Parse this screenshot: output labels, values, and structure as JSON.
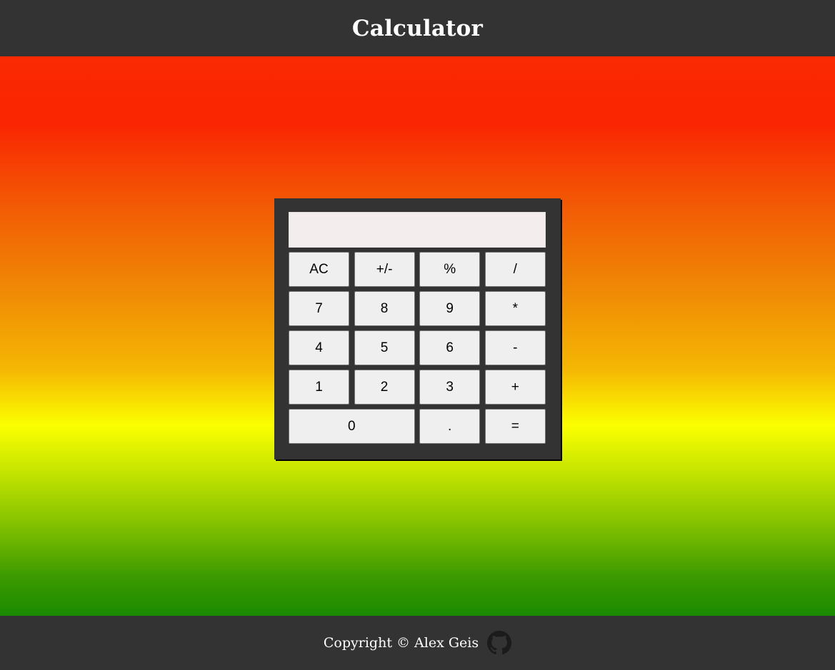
{
  "header": {
    "title": "Calculator"
  },
  "display": {
    "value": ""
  },
  "keys": [
    [
      "AC",
      "+/-",
      "%",
      "/"
    ],
    [
      "7",
      "8",
      "9",
      "*"
    ],
    [
      "4",
      "5",
      "6",
      "-"
    ],
    [
      "1",
      "2",
      "3",
      "+"
    ],
    [
      "0",
      ".",
      "="
    ]
  ],
  "footer": {
    "copyright": "Copyright © Alex Geis",
    "icon": "github-icon"
  },
  "colors": {
    "chrome": "#333333",
    "gradient": [
      "#fb2a02",
      "#f08a05",
      "#fbff00",
      "#1a8a00"
    ],
    "display_bg": "#f3eded",
    "key_bg": "#efefef"
  }
}
